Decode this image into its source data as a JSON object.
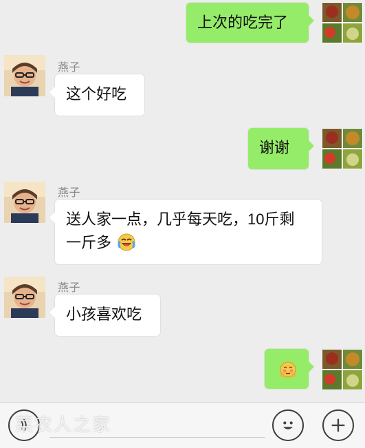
{
  "chat": {
    "messages": [
      {
        "side": "right",
        "text": "上次的吃完了"
      },
      {
        "side": "left",
        "sender": "燕子",
        "text": "这个好吃"
      },
      {
        "side": "right",
        "text": "谢谢"
      },
      {
        "side": "left",
        "sender": "燕子",
        "line1": "送人家一点，几乎每天吃，10斤剩",
        "line2": "一斤多",
        "emoji": "crying-laughing-emoji"
      },
      {
        "side": "left",
        "sender": "燕子",
        "text": "小孩喜欢吃"
      },
      {
        "side": "right",
        "emoji": "shy-face-emoji"
      }
    ]
  },
  "bottom_bar": {
    "watermark": "菜农人之家",
    "icons": [
      "voice-icon",
      "emoji-icon",
      "plus-icon"
    ]
  },
  "colors": {
    "chat_bg": "#ededed",
    "sent_bubble": "#95ec69",
    "received_bubble": "#ffffff"
  }
}
